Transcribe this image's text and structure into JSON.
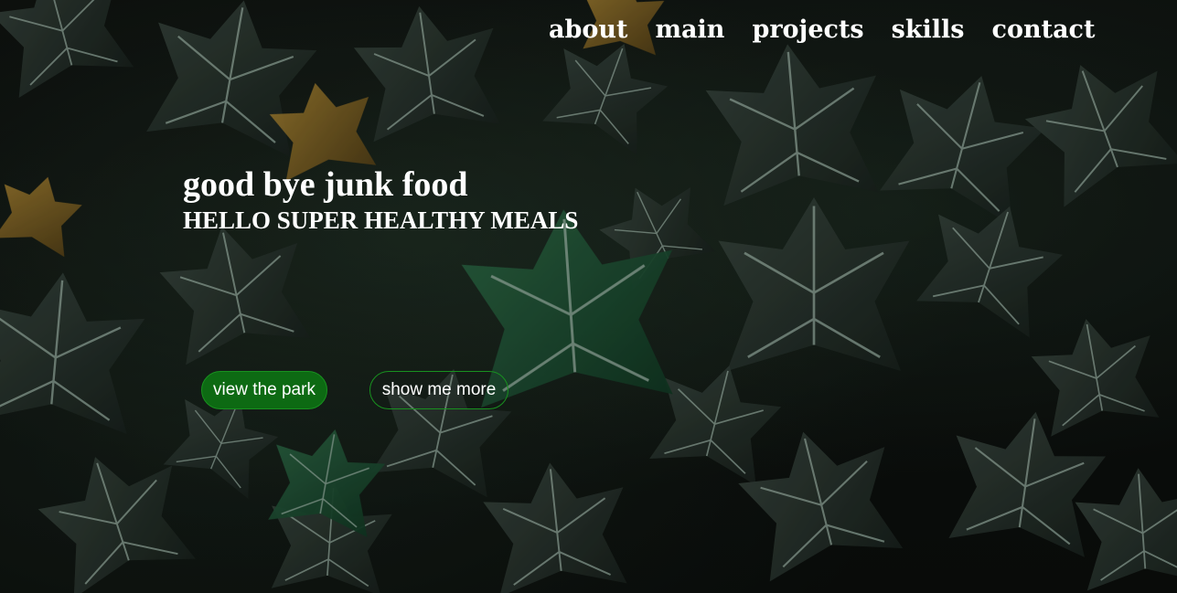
{
  "nav": {
    "items": [
      {
        "label": "about"
      },
      {
        "label": "main"
      },
      {
        "label": "projects"
      },
      {
        "label": "skills"
      },
      {
        "label": "contact"
      }
    ]
  },
  "hero": {
    "headline": "good bye junk food",
    "subheadline": "HELLO SUPER HEALTHY MEALS",
    "primary_button": "view the park",
    "secondary_button": "show me more",
    "background": "ivy-leaves-photo"
  },
  "colors": {
    "accent": "#0d6a13",
    "accent_border": "#18911f",
    "text": "#ffffff"
  }
}
